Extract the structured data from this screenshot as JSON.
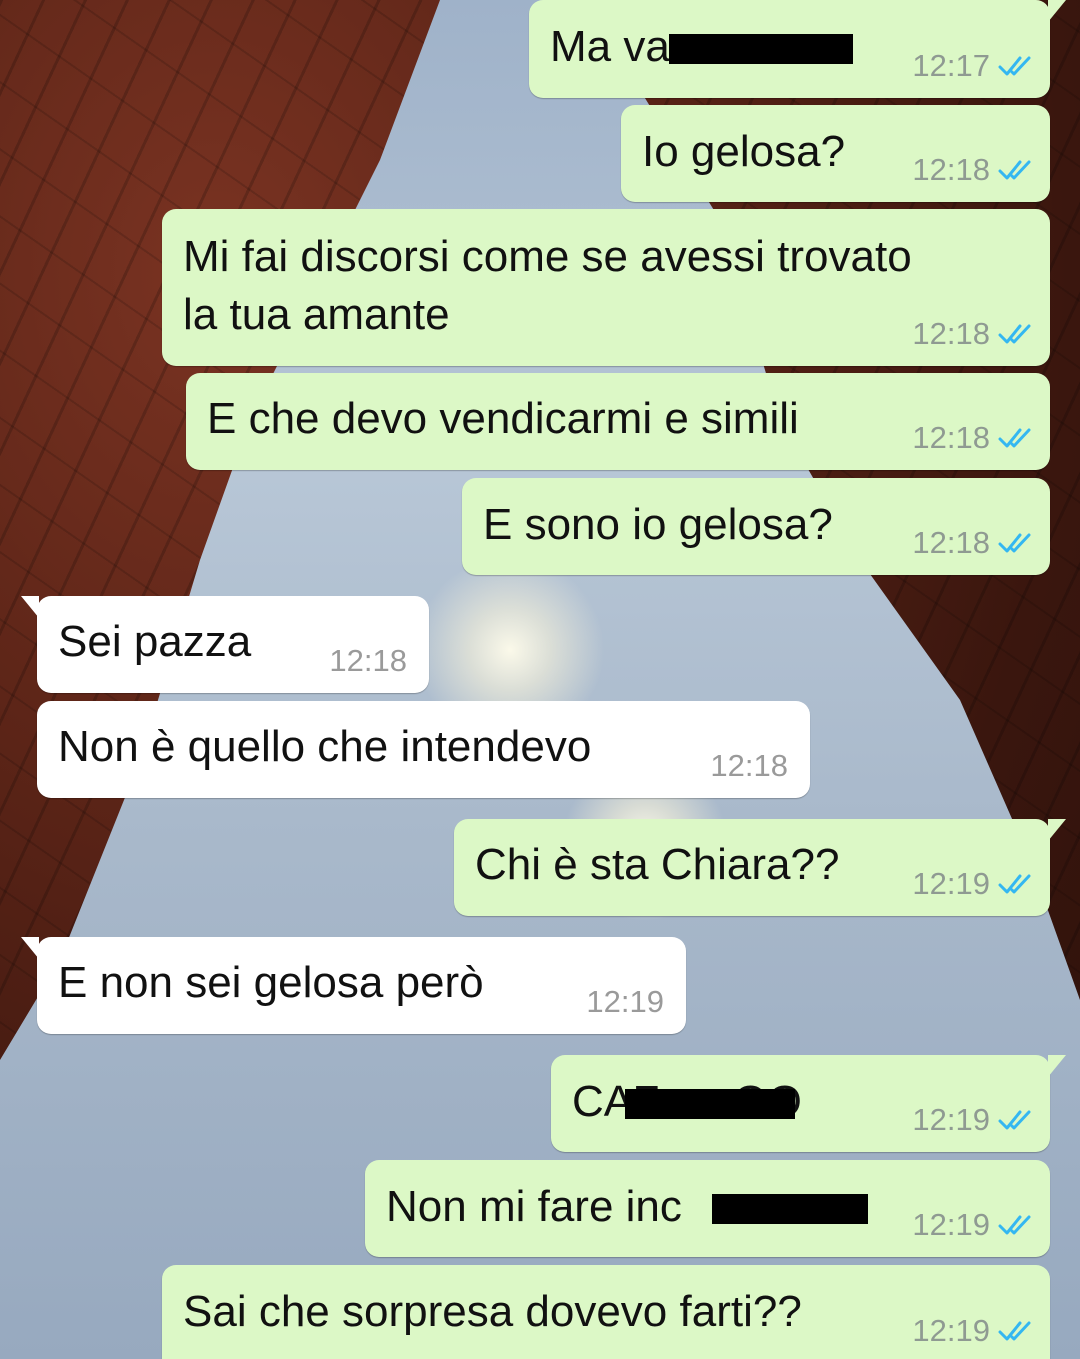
{
  "colors": {
    "outgoing_bubble": "#dcf8c6",
    "incoming_bubble": "#ffffff",
    "read_ticks": "#34b7f1",
    "timestamp": "#8f9a92"
  },
  "messages": [
    {
      "direction": "out",
      "text": "Ma va",
      "time": "12:17",
      "status": "read"
    },
    {
      "direction": "out",
      "text": "Io gelosa?",
      "time": "12:18",
      "status": "read"
    },
    {
      "direction": "out",
      "text": "Mi fai discorsi come se avessi trovato\nla tua amante",
      "time": "12:18",
      "status": "read"
    },
    {
      "direction": "out",
      "text": "E che devo vendicarmi e simili",
      "time": "12:18",
      "status": "read"
    },
    {
      "direction": "out",
      "text": "E sono io gelosa?",
      "time": "12:18",
      "status": "read"
    },
    {
      "direction": "in",
      "text": "Sei pazza",
      "time": "12:18"
    },
    {
      "direction": "in",
      "text": "Non è quello che intendevo",
      "time": "12:18"
    },
    {
      "direction": "out",
      "text": "Chi è sta Chiara??",
      "time": "12:19",
      "status": "read"
    },
    {
      "direction": "in",
      "text": "E non sei gelosa però",
      "time": "12:19"
    },
    {
      "direction": "out",
      "text": "CAZ      OO",
      "time": "12:19",
      "status": "read"
    },
    {
      "direction": "out",
      "text": "Non mi fare inc",
      "time": "12:19",
      "status": "read"
    },
    {
      "direction": "out",
      "text": "Sai che sorpresa dovevo farti??",
      "time": "12:19",
      "status": "read"
    }
  ],
  "icons": {
    "read_status": "double-check-icon"
  }
}
